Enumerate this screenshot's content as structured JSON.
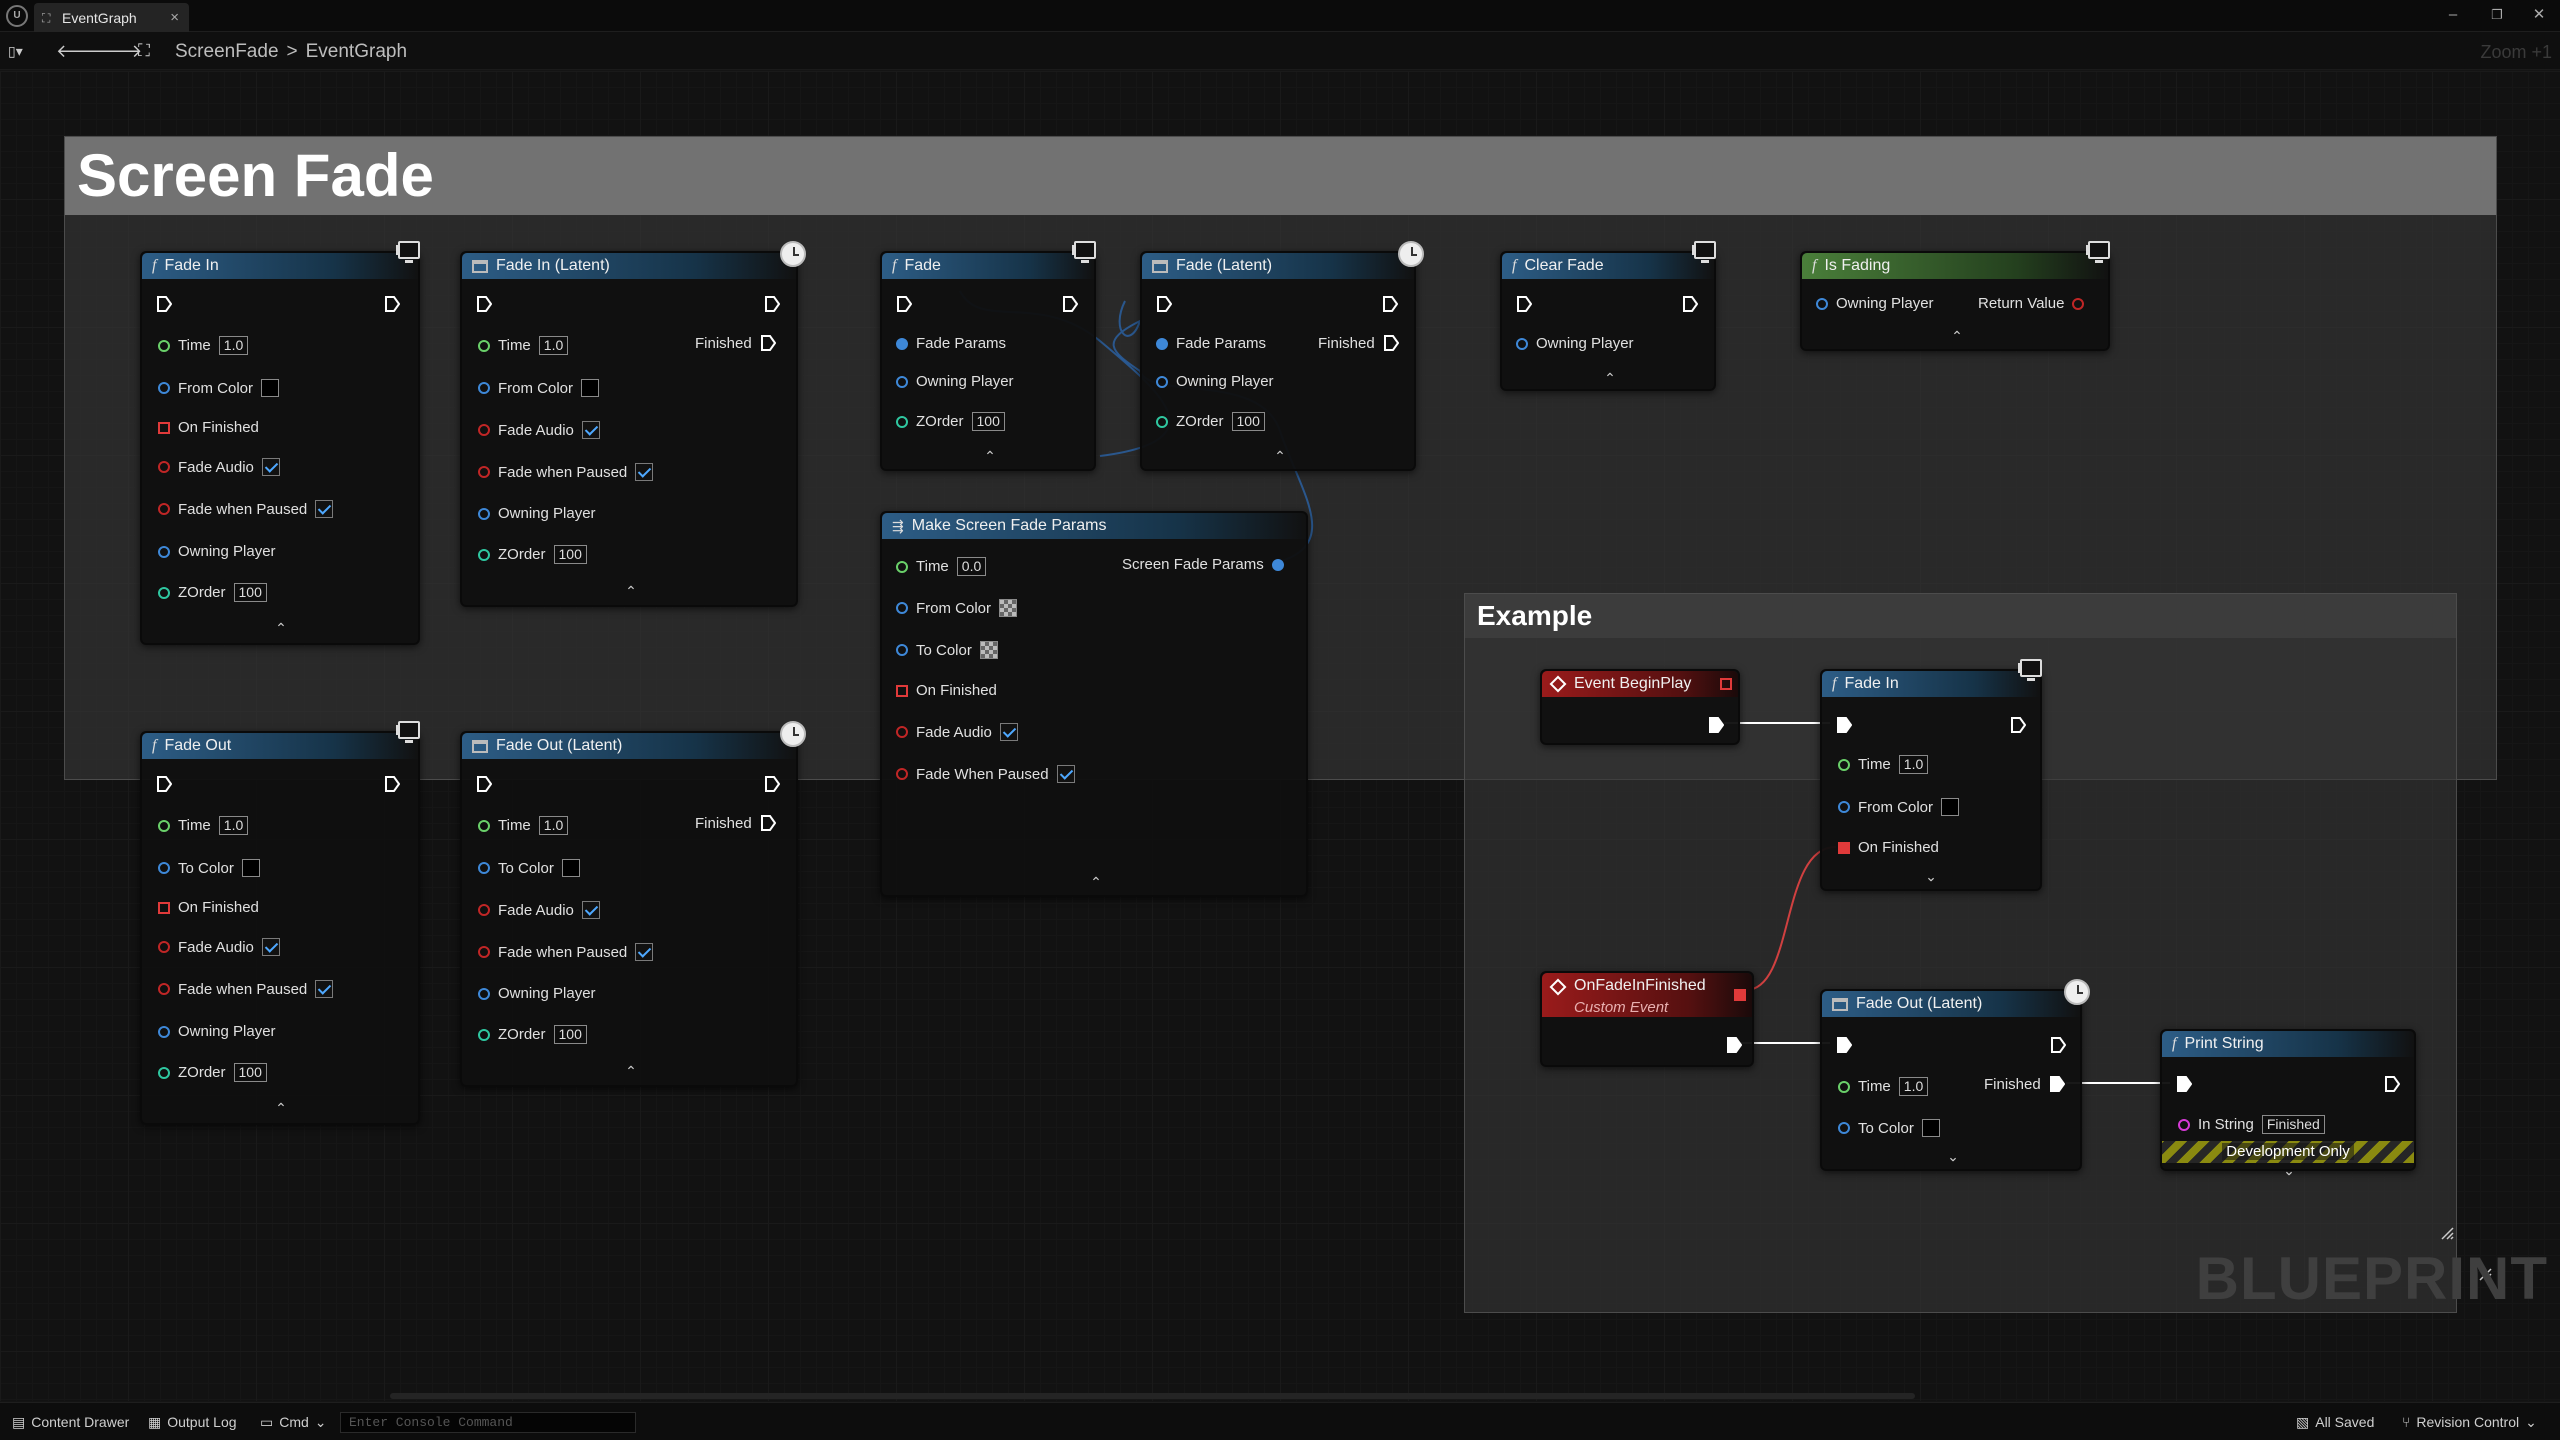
{
  "window": {
    "tab_label": "EventGraph",
    "tab_close": "×",
    "minimize": "–",
    "restore": "❐",
    "close": "✕"
  },
  "toolbar": {
    "breadcrumb": [
      "ScreenFade",
      "EventGraph"
    ],
    "breadcrumb_sep": ">",
    "zoom": "Zoom +1"
  },
  "graph": {
    "comment_main": "Screen Fade",
    "comment_example": "Example",
    "watermark": "BLUEPRINT"
  },
  "nodes": {
    "fade_in": {
      "title": "Fade In",
      "rows": {
        "time": "Time",
        "time_val": "1.0",
        "from_color": "From Color",
        "on_finished": "On Finished",
        "fade_audio": "Fade Audio",
        "fade_paused": "Fade when Paused",
        "owning_player": "Owning Player",
        "zorder": "ZOrder",
        "zorder_val": "100"
      }
    },
    "fade_in_latent": {
      "title": "Fade In (Latent)",
      "rows": {
        "time": "Time",
        "time_val": "1.0",
        "finished": "Finished",
        "from_color": "From Color",
        "fade_audio": "Fade Audio",
        "fade_paused": "Fade when Paused",
        "owning_player": "Owning Player",
        "zorder": "ZOrder",
        "zorder_val": "100"
      }
    },
    "fade_out": {
      "title": "Fade Out",
      "rows": {
        "time": "Time",
        "time_val": "1.0",
        "to_color": "To Color",
        "on_finished": "On Finished",
        "fade_audio": "Fade Audio",
        "fade_paused": "Fade when Paused",
        "owning_player": "Owning Player",
        "zorder": "ZOrder",
        "zorder_val": "100"
      }
    },
    "fade_out_latent": {
      "title": "Fade Out (Latent)",
      "rows": {
        "time": "Time",
        "time_val": "1.0",
        "finished": "Finished",
        "to_color": "To Color",
        "fade_audio": "Fade Audio",
        "fade_paused": "Fade when Paused",
        "owning_player": "Owning Player",
        "zorder": "ZOrder",
        "zorder_val": "100"
      }
    },
    "fade": {
      "title": "Fade",
      "rows": {
        "fade_params": "Fade Params",
        "owning_player": "Owning Player",
        "zorder": "ZOrder",
        "zorder_val": "100"
      }
    },
    "fade_latent": {
      "title": "Fade (Latent)",
      "rows": {
        "fade_params": "Fade Params",
        "finished": "Finished",
        "owning_player": "Owning Player",
        "zorder": "ZOrder",
        "zorder_val": "100"
      }
    },
    "clear_fade": {
      "title": "Clear Fade",
      "rows": {
        "owning_player": "Owning Player"
      }
    },
    "is_fading": {
      "title": "Is Fading",
      "rows": {
        "owning_player": "Owning Player",
        "return_value": "Return Value"
      }
    },
    "make_params": {
      "title": "Make Screen Fade Params",
      "rows": {
        "time": "Time",
        "time_val": "0.0",
        "output": "Screen Fade Params",
        "from_color": "From Color",
        "to_color": "To Color",
        "on_finished": "On Finished",
        "fade_audio": "Fade Audio",
        "fade_paused": "Fade When Paused"
      }
    },
    "event_begin_play": {
      "title": "Event BeginPlay"
    },
    "ex_fade_in": {
      "title": "Fade In",
      "rows": {
        "time": "Time",
        "time_val": "1.0",
        "from_color": "From Color",
        "on_finished": "On Finished"
      }
    },
    "on_fade_in_finished": {
      "title": "OnFadeInFinished",
      "subtitle": "Custom Event"
    },
    "ex_fade_out_latent": {
      "title": "Fade Out (Latent)",
      "rows": {
        "time": "Time",
        "time_val": "1.0",
        "finished": "Finished",
        "to_color": "To Color"
      }
    },
    "print_string": {
      "title": "Print String",
      "rows": {
        "in_string": "In String",
        "in_string_val": "Finished",
        "dev_only": "Development Only"
      }
    }
  },
  "statusbar": {
    "content_drawer": "Content Drawer",
    "output_log": "Output Log",
    "cmd": "Cmd",
    "console_placeholder": "Enter Console Command",
    "all_saved": "All Saved",
    "revision_control": "Revision Control"
  },
  "colors": {
    "exec": "#ffffff",
    "float_pin": "#6ad06a",
    "struct_pin": "#3e88d8",
    "bool_pin": "#c02626",
    "string_pin": "#d63ad6",
    "function_header": "#2d5d86",
    "pure_header": "#4a7f3a",
    "event_header": "#9a1b1b"
  }
}
